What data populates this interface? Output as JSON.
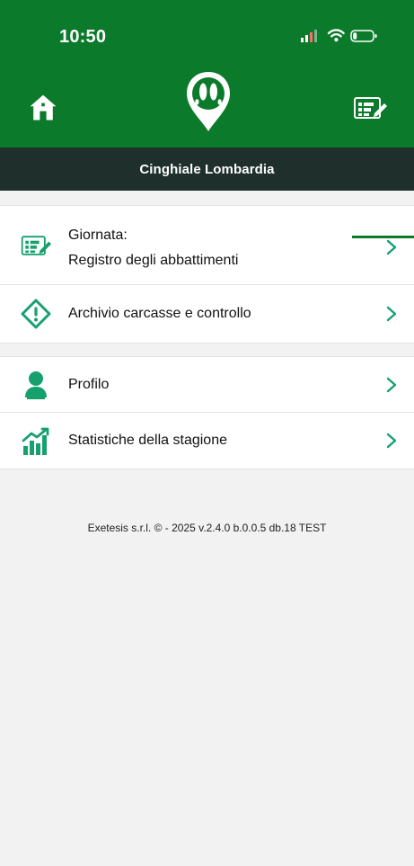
{
  "status_bar": {
    "time": "10:50"
  },
  "header": {
    "left_icon": "home-icon",
    "center_icon": "boar-footprint-logo-icon",
    "right_icon": "register-icon"
  },
  "subheader": {
    "title": "Cinghiale Lombardia"
  },
  "menu": {
    "primary_group": [
      {
        "line1": "Giornata:",
        "line2": "Registro degli abbattimenti",
        "icon": "register-icon"
      },
      {
        "label": "Archivio carcasse e controllo",
        "icon": "warning-diamond-icon"
      }
    ],
    "secondary_group": [
      {
        "label": "Profilo",
        "icon": "user-icon"
      },
      {
        "label": "Statistiche della stagione",
        "icon": "stats-chart-icon"
      }
    ]
  },
  "footer": {
    "text": "Exetesis s.r.l. © - 2025 v.2.4.0 b.0.0.5 db.18 TEST"
  },
  "colors": {
    "brand_green": "#0c7a2b",
    "accent_green": "#1bbf7a",
    "subheader_bg": "#1f2f2b",
    "background": "#f2f2f2"
  }
}
